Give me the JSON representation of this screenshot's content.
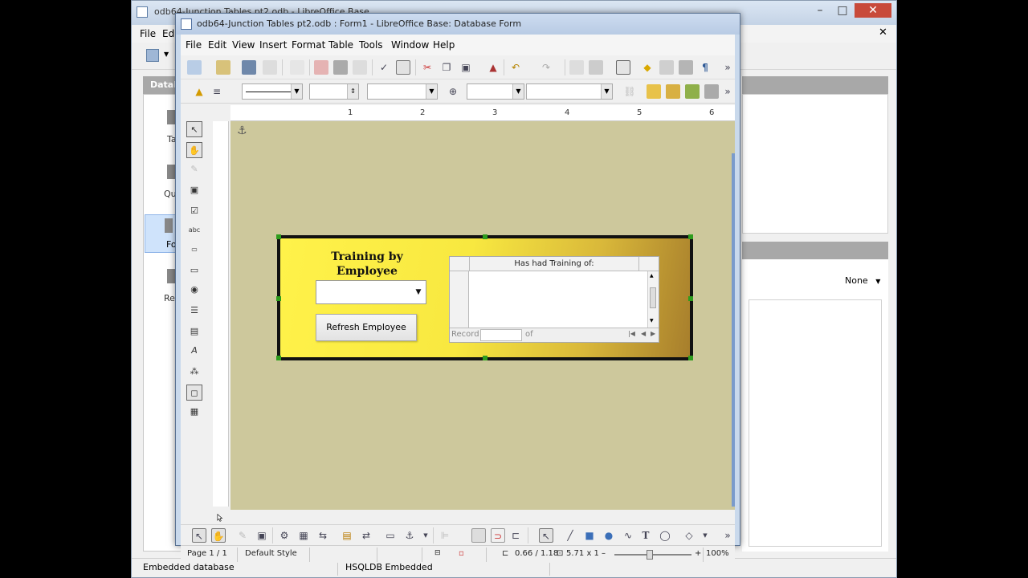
{
  "base_window": {
    "title": "odb64-Junction Tables pt2.odb - LibreOffice Base",
    "menus": [
      "File",
      "Edi"
    ],
    "left_header": "Datab",
    "side_items": [
      "Ta",
      "Qu",
      "Fo",
      "Re"
    ],
    "right_none": "None",
    "status_left": "Embedded database",
    "status_right": "HSQLDB Embedded",
    "close_glyph": "✕"
  },
  "form_window": {
    "title": "odb64-Junction Tables pt2.odb : Form1 - LibreOffice Base: Database Form",
    "menus": [
      "File",
      "Edit",
      "View",
      "Insert",
      "Format",
      "Table",
      "Tools",
      "Window",
      "Help"
    ],
    "ruler_numbers": [
      "1",
      "2",
      "3",
      "4",
      "5",
      "6"
    ],
    "form": {
      "title": "Training by Employee",
      "combo_value": "",
      "refresh_label": "Refresh Employee",
      "grid_column": "Has had Training of:",
      "record_label": "Record",
      "of_label": "of"
    },
    "status": {
      "page": "Page 1 / 1",
      "style": "Default Style",
      "position": "0.66 / 1.18",
      "size": "5.71 x 1",
      "zoom": "100%"
    }
  },
  "colors": {
    "canvas": "#cdc89c",
    "form_gradient_start": "#fff24a",
    "form_gradient_end": "#a77e2c",
    "handle": "#2e9c1d"
  }
}
